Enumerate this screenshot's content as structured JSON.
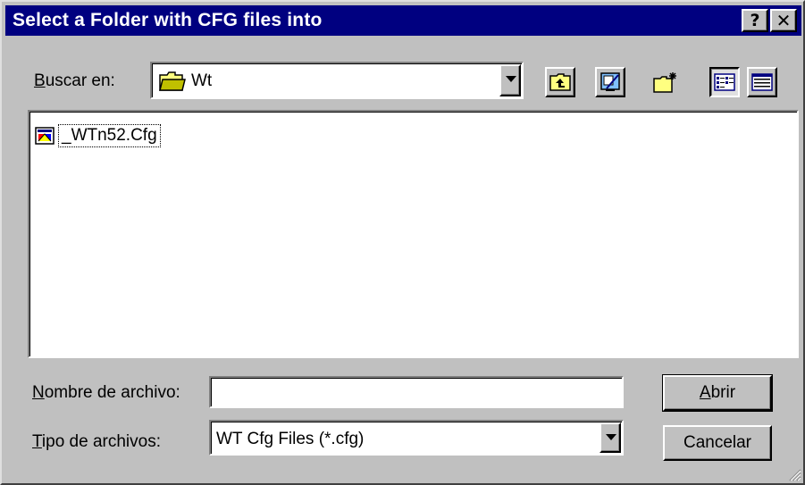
{
  "window": {
    "title": "Select a Folder with CFG files into",
    "help_glyph": "?",
    "close_glyph": "✕"
  },
  "look_in": {
    "label_mnemonic": "B",
    "label_rest": "uscar en:",
    "value": "Wt"
  },
  "toolbar": {
    "buttons": [
      {
        "icon": "up-one-level-icon"
      },
      {
        "icon": "desktop-icon"
      },
      {
        "icon": "new-folder-icon"
      },
      {
        "icon": "list-view-icon",
        "pressed": true
      },
      {
        "icon": "details-view-icon"
      }
    ]
  },
  "file_list": {
    "items": [
      {
        "name": "_WTn52.Cfg",
        "icon": "cfg-file-icon",
        "focused": true
      }
    ]
  },
  "file_name": {
    "label_mnemonic": "N",
    "label_rest": "ombre de archivo:",
    "value": ""
  },
  "file_type": {
    "label_mnemonic": "T",
    "label_rest": "ipo de archivos:",
    "value": "WT Cfg Files (*.cfg)"
  },
  "buttons": {
    "open_mnemonic": "A",
    "open_rest": "brir",
    "cancel": "Cancelar"
  },
  "colors": {
    "titlebar": "#000080",
    "face": "#c0c0c0",
    "window": "#ffffff"
  }
}
